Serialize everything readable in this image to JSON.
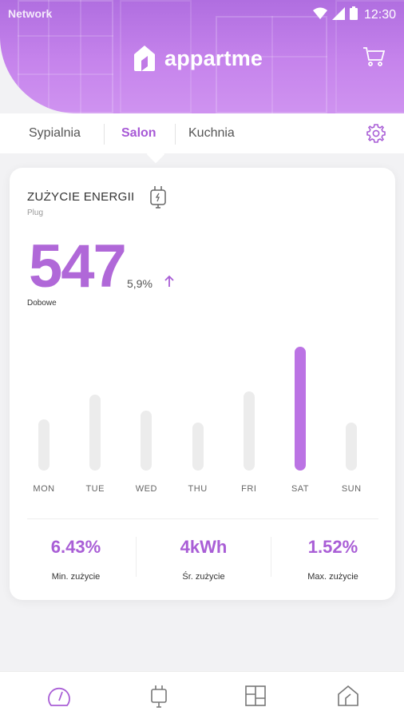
{
  "status": {
    "network": "Network",
    "time": "12:30"
  },
  "app": {
    "name": "appartme"
  },
  "tabs": [
    {
      "label": "Sypialnia",
      "active": false
    },
    {
      "label": "Salon",
      "active": true
    },
    {
      "label": "Kuchnia",
      "active": false
    }
  ],
  "card": {
    "title": "ZUŻYCIE ENERGII",
    "subtitle": "Plug",
    "value": "547",
    "change": "5,9%",
    "value_label": "Dobowe"
  },
  "chart_data": {
    "type": "bar",
    "categories": [
      "MON",
      "TUE",
      "WED",
      "THU",
      "FRI",
      "SAT",
      "SUN"
    ],
    "values": [
      30,
      44,
      35,
      28,
      46,
      72,
      28
    ],
    "highlighted": "SAT",
    "ylim": [
      0,
      80
    ]
  },
  "stats": [
    {
      "value": "6.43%",
      "label": "Min. zużycie"
    },
    {
      "value": "4kWh",
      "label": "Śr. zużycie"
    },
    {
      "value": "1.52%",
      "label": "Max. zużycie"
    }
  ],
  "colors": {
    "accent": "#a95ed6",
    "bar_active": "#bb73e4",
    "bar_inactive": "#ececec"
  },
  "bottom_nav": [
    "gauge-icon",
    "plug-icon",
    "rooms-icon",
    "home-icon"
  ]
}
